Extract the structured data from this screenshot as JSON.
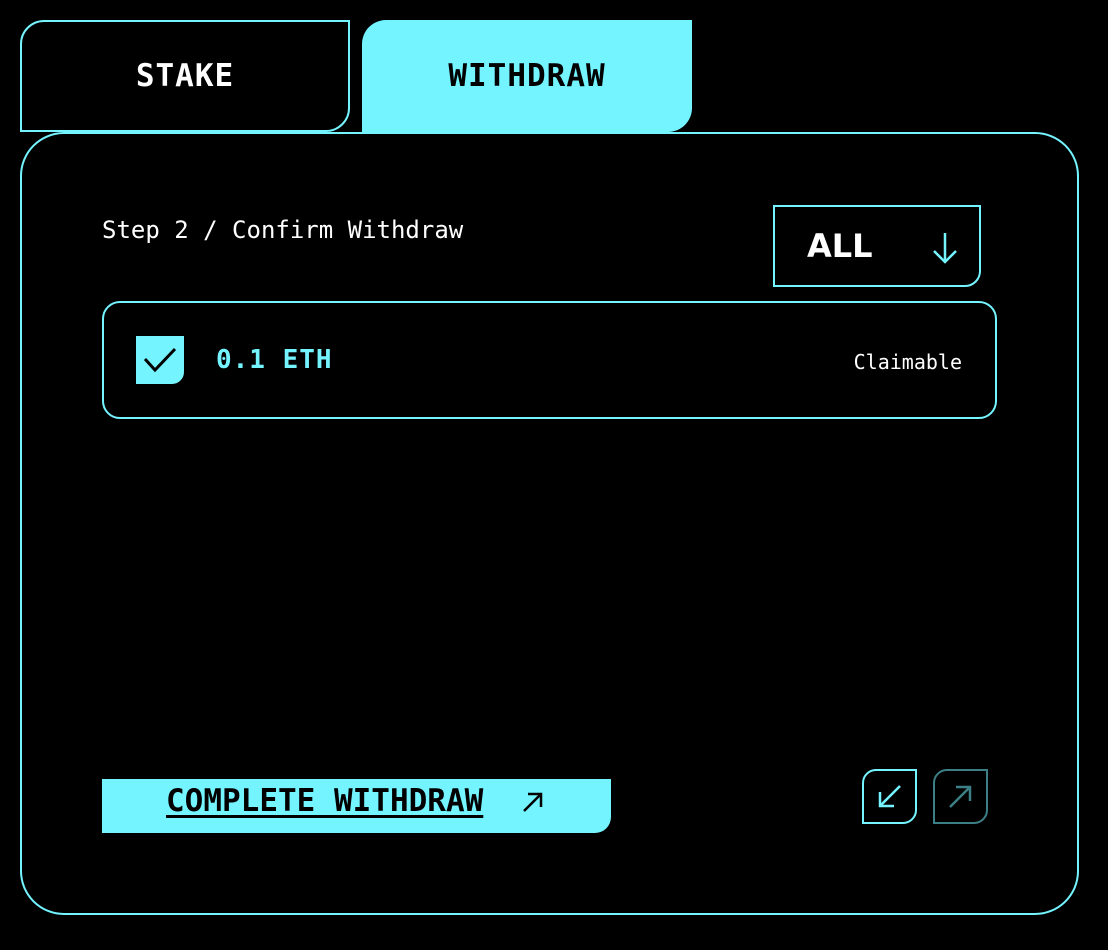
{
  "tabs": {
    "stake": "STAKE",
    "withdraw": "WITHDRAW",
    "active": "withdraw"
  },
  "step_text": "Step 2 / Confirm Withdraw",
  "filter": {
    "selected": "ALL",
    "icon": "arrow-down-icon"
  },
  "items": [
    {
      "amount": "0.1 ETH",
      "status": "Claimable",
      "checked": true
    }
  ],
  "actions": {
    "complete_label": "COMPLETE WITHDRAW",
    "complete_icon": "arrow-up-right-icon"
  },
  "pager": {
    "prev_icon": "arrow-down-left-icon",
    "next_icon": "arrow-up-right-icon",
    "next_disabled": true
  },
  "colors": {
    "accent": "#74f4ff",
    "background": "#000000",
    "text": "#ffffff",
    "muted_accent": "#3d7f86"
  }
}
